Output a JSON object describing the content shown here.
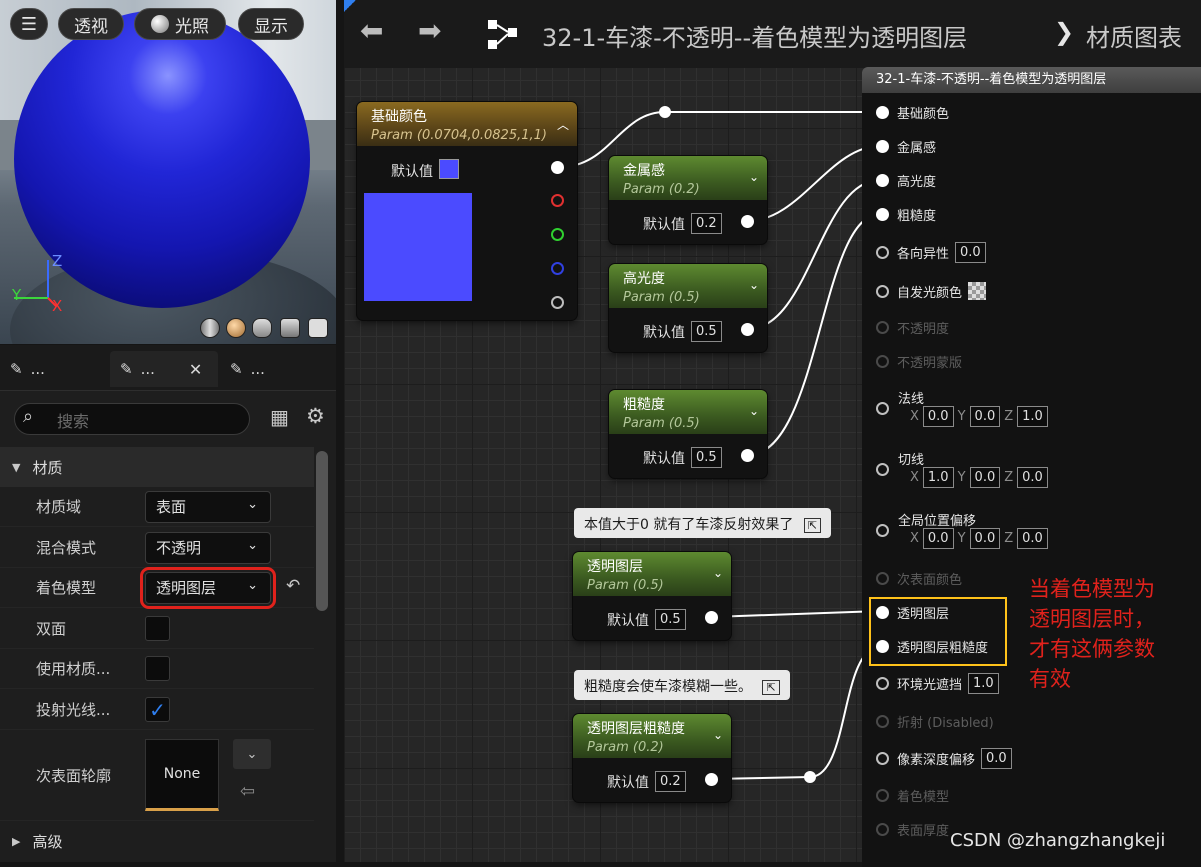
{
  "viewport": {
    "btn_perspective": "透视",
    "btn_lighting": "光照",
    "btn_show": "显示",
    "axis_z": "Z",
    "axis_y": "Y",
    "axis_x": "X"
  },
  "tabs": [
    {
      "label": "..."
    },
    {
      "label": "..."
    },
    {
      "label": "..."
    }
  ],
  "search": {
    "placeholder": "搜索"
  },
  "details": {
    "section_material": "材质",
    "rows": [
      {
        "label": "材质域",
        "value": "表面"
      },
      {
        "label": "混合模式",
        "value": "不透明"
      },
      {
        "label": "着色模型",
        "value": "透明图层"
      },
      {
        "label": "双面",
        "checked": false
      },
      {
        "label": "使用材质...",
        "checked": false
      },
      {
        "label": "投射光线...",
        "checked": true
      },
      {
        "label": "次表面轮廓",
        "value": "None"
      }
    ],
    "section_advanced": "高级"
  },
  "breadcrumb": {
    "asset": "32-1-车漆-不透明--着色模型为透明图层",
    "separator": "❯",
    "page": "材质图表"
  },
  "nodes": {
    "base_color": {
      "title": "基础颜色",
      "param": "Param (0.0704,0.0825,1,1)",
      "default_label": "默认值",
      "swatch": "#4b4bff"
    },
    "metallic": {
      "title": "金属感",
      "param": "Param (0.2)",
      "default_label": "默认值",
      "value": "0.2"
    },
    "specular": {
      "title": "高光度",
      "param": "Param (0.5)",
      "default_label": "默认值",
      "value": "0.5"
    },
    "roughness": {
      "title": "粗糙度",
      "param": "Param (0.5)",
      "default_label": "默认值",
      "value": "0.5"
    },
    "clearcoat": {
      "title": "透明图层",
      "param": "Param (0.5)",
      "default_label": "默认值",
      "value": "0.5"
    },
    "clearcoat_rough": {
      "title": "透明图层粗糙度",
      "param": "Param (0.2)",
      "default_label": "默认值",
      "value": "0.2"
    }
  },
  "comments": {
    "c1": "本值大于0 就有了车漆反射效果了",
    "c2": "粗糙度会使车漆模糊一些。"
  },
  "result": {
    "title": "32-1-车漆-不透明--着色模型为透明图层",
    "pins": {
      "base": "基础颜色",
      "metal": "金属感",
      "spec": "高光度",
      "rough": "粗糙度",
      "aniso": "各向异性",
      "aniso_val": "0.0",
      "emissive": "自发光颜色",
      "opacity": "不透明度",
      "opacity_mask": "不透明蒙版",
      "normal": "法线",
      "normal_x": "0.0",
      "normal_y": "0.0",
      "normal_z": "1.0",
      "tangent": "切线",
      "tangent_x": "1.0",
      "tangent_y": "0.0",
      "tangent_z": "0.0",
      "wpo": "全局位置偏移",
      "wpo_x": "0.0",
      "wpo_y": "0.0",
      "wpo_z": "0.0",
      "subsurface": "次表面颜色",
      "clearcoat": "透明图层",
      "clearcoat_rough": "透明图层粗糙度",
      "ao": "环境光遮挡",
      "ao_val": "1.0",
      "refraction": "折射 (Disabled)",
      "pdo": "像素深度偏移",
      "pdo_val": "0.0",
      "shading": "着色模型",
      "thickness": "表面厚度"
    },
    "axis_x": "X",
    "axis_y": "Y",
    "axis_z": "Z"
  },
  "annotation": "当着色模型为\n透明图层时，\n才有这俩参数\n有效",
  "watermark": "CSDN @zhangzhangkeji",
  "colors": {
    "highlight_red": "#e0221c",
    "highlight_yellow": "#ffc21a",
    "accent_blue": "#2f7ff0"
  }
}
